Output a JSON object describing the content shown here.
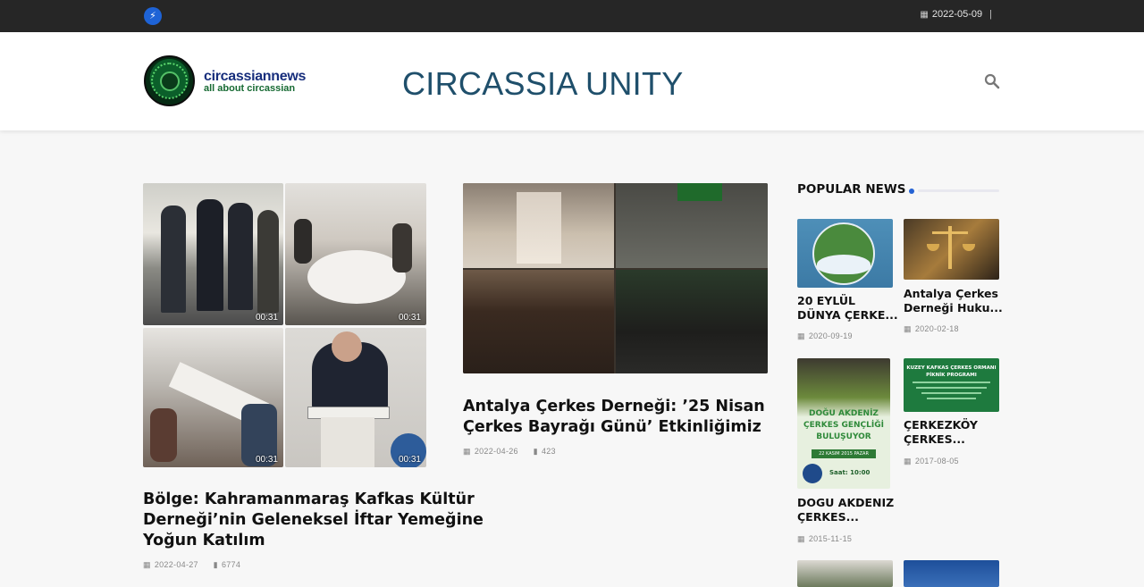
{
  "topbar": {
    "date": "2022-05-09",
    "separator": "|",
    "bolt_icon": "bolt-icon"
  },
  "header": {
    "logo_line1": "circassiannews",
    "logo_line2": "all about circassian",
    "site_title": "CIRCASSIA UNITY",
    "search_icon": "search-icon"
  },
  "colors": {
    "topbar": "#262626",
    "accent": "#2563d4",
    "title_blue": "#1f4f6b"
  },
  "articles": [
    {
      "title_lines": [
        "Bölge: Kahramanmaraş Kafkas Kültür",
        "Derneği’nin Geleneksel İftar Yemeğine",
        "Yoğun Katılım"
      ],
      "date": "2022-04-27",
      "views": "6774",
      "durations": [
        "00:31",
        "00:31",
        "00:31",
        "00:31"
      ]
    },
    {
      "title_lines": [
        "Antalya Çerkes Derneği: ’25 Nisan",
        "Çerkes Bayrağı Günü’ Etkinliğimiz"
      ],
      "date": "2022-04-26",
      "views": "423"
    }
  ],
  "popular": {
    "heading": "POPULAR NEWS",
    "items": [
      {
        "title_lines": [
          "20 EYLÜL",
          "DÜNYA ÇERKE..."
        ],
        "date": "2020-09-19"
      },
      {
        "title_lines": [
          "Antalya Çerkes",
          "Derneği Huku..."
        ],
        "date": "2020-02-18"
      },
      {
        "title_lines": [
          "DOGU AKDENIZ",
          "ÇERKES..."
        ],
        "date": "2015-11-15",
        "poster": {
          "l1": "DOĞU AKDENİZ",
          "l2": "ÇERKES GENÇLİĞİ",
          "l3": "BULUŞUYOR",
          "ribbon": "22 KASIM 2015 PAZAR",
          "time": "Saat: 10:00"
        }
      },
      {
        "title_lines": [
          "ÇERKEZKÖY",
          "ÇERKES..."
        ],
        "date": "2017-08-05",
        "poster": {
          "l1": "KUZEY KAFKAS ÇERKES ORMANI",
          "l2": "PİKNİK PROGRAMI"
        }
      }
    ]
  }
}
